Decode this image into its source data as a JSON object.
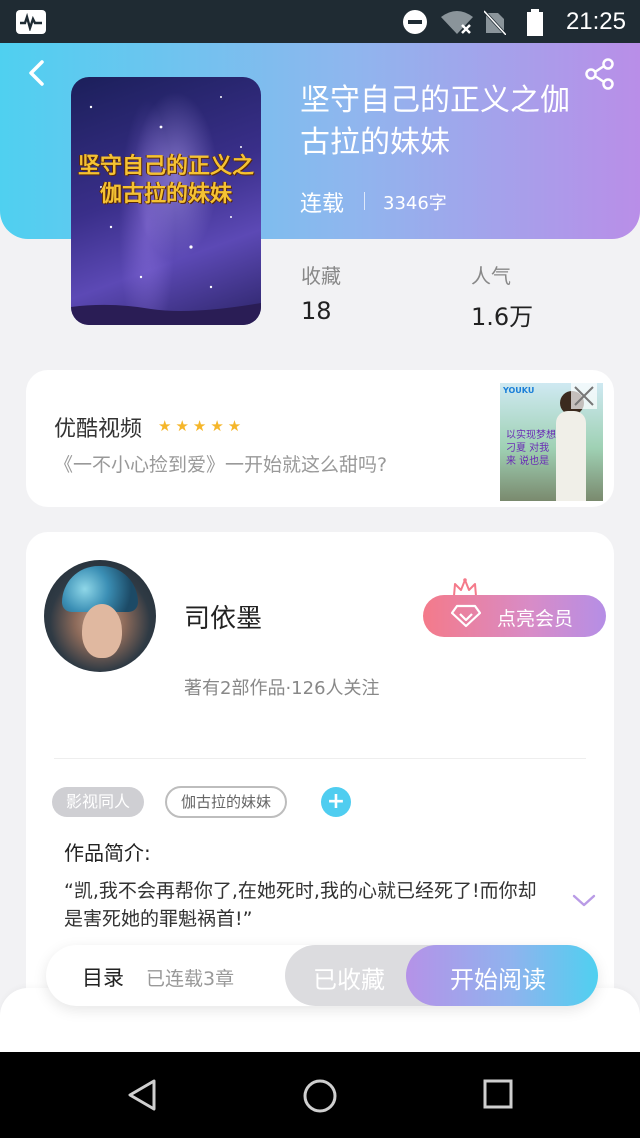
{
  "status_bar": {
    "time": "21:25"
  },
  "book": {
    "title": "坚守自己的正义之伽古拉的妹妹",
    "cover_title_line1": "坚守自己的正义之",
    "cover_title_line2": "伽古拉的妹妹",
    "status": "连载",
    "word_count": "3346字",
    "stats": [
      {
        "label": "收藏",
        "value": "18"
      },
      {
        "label": "人气",
        "value": "1.6万"
      }
    ]
  },
  "ad": {
    "name": "优酷视频",
    "stars": "★★★★★",
    "description": "《一不小心捡到爱》一开始就这么甜吗?",
    "thumb_brand": "YOUKU",
    "thumb_text": "以实现梦想 刁夏 对我来 说也是"
  },
  "author": {
    "name": "司依墨",
    "meta": "著有2部作品·126人关注",
    "vip_label": "点亮会员"
  },
  "tags": [
    "影视同人",
    "伽古拉的妹妹"
  ],
  "tag_add": "+",
  "intro": {
    "heading": "作品简介:",
    "text": "“凯,我不会再帮你了,在她死时,我的心就已经死了!而你却是害死她的罪魁祸首!”"
  },
  "action_bar": {
    "toc_label": "目录",
    "toc_count": "已连载3章",
    "collected_label": "已收藏",
    "read_label": "开始阅读"
  },
  "icons": {
    "back": "back-arrow-icon",
    "share": "share-icon",
    "close": "close-icon",
    "expand": "chevron-down-icon"
  },
  "colors": {
    "header_gradient_start": "#4fd0f0",
    "header_gradient_end": "#b98ee8",
    "vip_gradient_start": "#f47a8a",
    "vip_gradient_end": "#b58ee6",
    "star": "#f5b62a",
    "tag_add": "#4fcdf0"
  }
}
